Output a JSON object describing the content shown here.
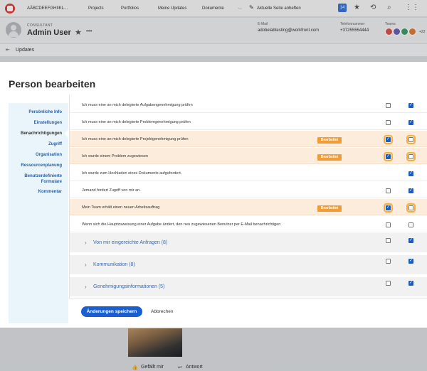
{
  "topbar": {
    "app_name": "AÄBCDEEFGHIIKL...",
    "nav": [
      "Projects",
      "Portfolios",
      "Meine Updates",
      "Dokumente"
    ],
    "more": "···",
    "pin_label": "Aktuelle Seite anheften",
    "badge": "14"
  },
  "profile": {
    "role": "CONSULTANT",
    "name": "Admin User",
    "email_label": "E-Mail",
    "email": "adobelabtesting@workfront.com",
    "phone_label": "Telefonnummer",
    "phone": "+37255554444",
    "teams_label": "Teams",
    "teams_more": "+22",
    "team_colors": [
      "#d9534f",
      "#6b5fb5",
      "#3f9e6a",
      "#e07b39"
    ]
  },
  "subbar": {
    "label": "Updates"
  },
  "background_actions": {
    "like": "Gefällt mir",
    "reply": "Antwort"
  },
  "modal": {
    "title": "Person bearbeiten",
    "nav": [
      "Persönliche Info",
      "Einstellungen",
      "Benachrichtigungen",
      "Zugriff",
      "Organisation",
      "Ressourcenplanung",
      "Benutzerdefinierte Formulare",
      "Kommentar"
    ],
    "edited_tag": "Bearbeitet",
    "rows": [
      {
        "text": "Ich muss eine an mich delegierte Aufgabengenehmigung prüfen",
        "highlight": false,
        "tag": false,
        "in_app": false,
        "email": true
      },
      {
        "text": "Ich muss eine an mich delegierte Problemgenehmigung prüfen",
        "highlight": false,
        "tag": false,
        "in_app": false,
        "email": true
      },
      {
        "text": "Ich muss eine an mich delegierte Projektgenehmigung prüfen",
        "highlight": true,
        "tag": true,
        "in_app": true,
        "email": false
      },
      {
        "text": "Ich wurde einem Problem zugewiesen",
        "highlight": true,
        "tag": true,
        "in_app": true,
        "email": false
      },
      {
        "text": "Ich wurde zum Hochladen eines Dokuments aufgefordert.",
        "highlight": false,
        "tag": false,
        "in_app": null,
        "email": true
      },
      {
        "text": "Jemand fordert Zugriff von mir an.",
        "highlight": false,
        "tag": false,
        "in_app": false,
        "email": true
      },
      {
        "text": "Mein Team erhält einen neuen Arbeitsauftrag",
        "highlight": true,
        "tag": true,
        "in_app": true,
        "email": false
      },
      {
        "text": "Wenn sich die Hauptzuweisung einer Aufgabe ändert, den neu zugewiesenen Benutzer per E-Mail benachrichtigen",
        "highlight": false,
        "tag": false,
        "in_app": false,
        "email": false
      }
    ],
    "groups": [
      {
        "label": "Von mir eingereichte Anfragen (8)",
        "in_app": false,
        "email": true
      },
      {
        "label": "Kommunikation (8)",
        "in_app": false,
        "email": true
      },
      {
        "label": "Genehmigungsinformationen (5)",
        "in_app": false,
        "email": true
      }
    ],
    "save_label": "Änderungen speichern",
    "cancel_label": "Abbrechen"
  }
}
